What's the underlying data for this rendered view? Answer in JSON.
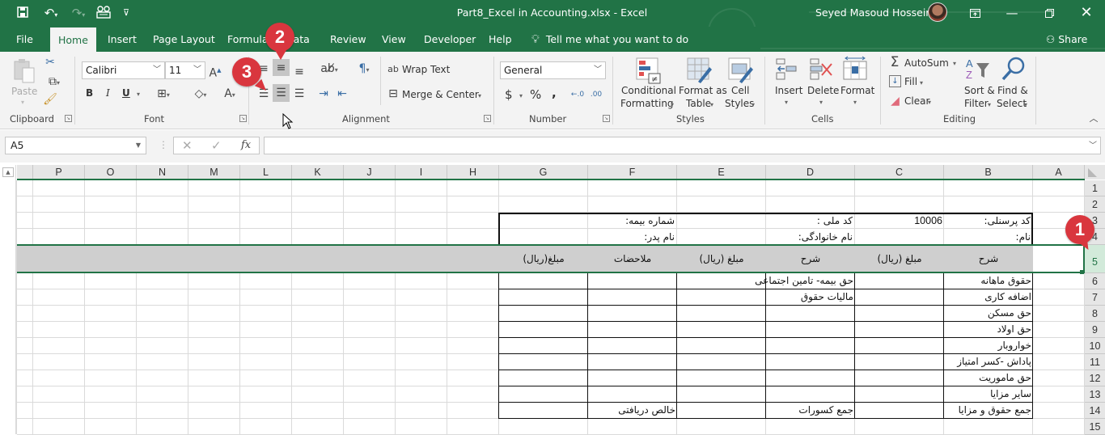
{
  "window": {
    "title": "Part8_Excel in Accounting.xlsx  -  Excel",
    "user": "Seyed Masoud Hosseini",
    "accent": "#217346"
  },
  "qat": [
    "save-icon",
    "undo-icon",
    "redo-icon",
    "form-icon",
    "customize-qat-icon"
  ],
  "tabs": [
    {
      "label": "File"
    },
    {
      "label": "Home"
    },
    {
      "label": "Insert"
    },
    {
      "label": "Page Layout"
    },
    {
      "label": "Formulas"
    },
    {
      "label": "Data"
    },
    {
      "label": "Review"
    },
    {
      "label": "View"
    },
    {
      "label": "Developer"
    },
    {
      "label": "Help"
    }
  ],
  "tellme": "Tell me what you want to do",
  "share": "Share",
  "ribbon": {
    "clipboard": {
      "label": "Clipboard",
      "paste": "Paste"
    },
    "font": {
      "label": "Font",
      "name": "Calibri",
      "size": "11",
      "bold": "B",
      "italic": "I",
      "underline": "U"
    },
    "alignment": {
      "label": "Alignment",
      "wrap": "Wrap Text",
      "merge": "Merge & Center"
    },
    "number": {
      "label": "Number",
      "format": "General",
      "currency": "$",
      "percent": "%",
      "comma": ","
    },
    "styles": {
      "label": "Styles",
      "conditional_1": "Conditional",
      "conditional_2": "Formatting",
      "format_table_1": "Format as",
      "format_table_2": "Table",
      "cell_styles_1": "Cell",
      "cell_styles_2": "Styles"
    },
    "cells": {
      "label": "Cells",
      "insert": "Insert",
      "delete": "Delete",
      "format": "Format"
    },
    "editing": {
      "label": "Editing",
      "autosum": "AutoSum",
      "fill": "Fill",
      "clear": "Clear",
      "sort_1": "Sort &",
      "sort_2": "Filter",
      "find_1": "Find &",
      "find_2": "Select"
    }
  },
  "formula_bar": {
    "name_box": "A5",
    "formula": "",
    "fx": "fx"
  },
  "columns": [
    "P",
    "O",
    "N",
    "M",
    "L",
    "K",
    "J",
    "I",
    "H",
    "G",
    "F",
    "E",
    "D",
    "C",
    "B",
    "A"
  ],
  "rows": [
    "1",
    "2",
    "3",
    "4",
    "5",
    "6",
    "7",
    "8",
    "9",
    "10",
    "11",
    "12",
    "13",
    "14",
    "15"
  ],
  "sheet": {
    "info": {
      "personnel_code_label": "کد پرسنلی:",
      "personnel_code_value": "10006",
      "national_code_label": "کد ملی :",
      "insurance_number_label": "شماره بیمه:",
      "name_label": "نام:",
      "family_label": "نام خانوادگی:",
      "father_label": "نام پدر:"
    },
    "headers": {
      "B": "شرح",
      "C": "مبلغ (ریال)",
      "D": "شرح",
      "E": "مبلغ (ریال)",
      "F": "ملاحضات",
      "G": "مبلغ(ریال)"
    },
    "earnings": [
      "حقوق ماهانه",
      "اضافه کاری",
      "حق مسکن",
      "حق اولاد",
      "خواروبار",
      "پاداش -کسر امتیاز",
      "حق ماموریت",
      "سایر مزایا",
      "جمع حقوق و مزایا"
    ],
    "deductions": [
      "حق بیمه- تامین اجتماعی",
      "مالیات حقوق"
    ],
    "total_deductions": "جمع کسورات",
    "net_pay": "خالص دریافتی"
  },
  "annotations": [
    {
      "n": "1"
    },
    {
      "n": "2"
    },
    {
      "n": "3"
    }
  ]
}
